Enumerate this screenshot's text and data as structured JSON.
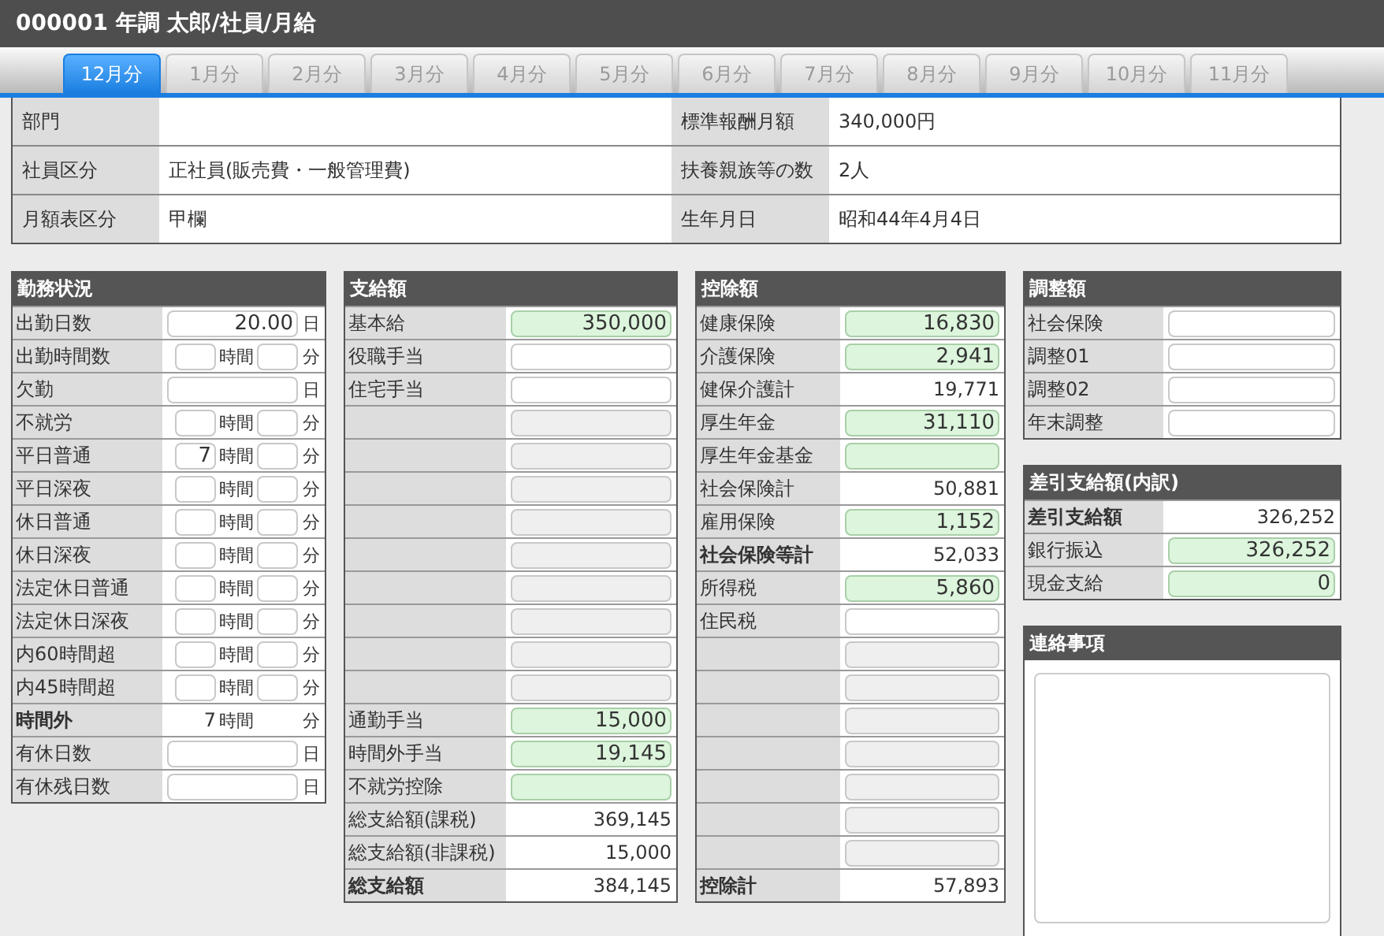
{
  "title": "000001 年調 太郎/社員/月給",
  "tabs": [
    {
      "label": "12月分",
      "selected": true
    },
    {
      "label": "1月分",
      "selected": false
    },
    {
      "label": "2月分",
      "selected": false
    },
    {
      "label": "3月分",
      "selected": false
    },
    {
      "label": "4月分",
      "selected": false
    },
    {
      "label": "5月分",
      "selected": false
    },
    {
      "label": "6月分",
      "selected": false
    },
    {
      "label": "7月分",
      "selected": false
    },
    {
      "label": "8月分",
      "selected": false
    },
    {
      "label": "9月分",
      "selected": false
    },
    {
      "label": "10月分",
      "selected": false
    },
    {
      "label": "11月分",
      "selected": false
    }
  ],
  "info": [
    {
      "label": "部門"
    },
    {
      "label": "標準報酬月額",
      "value": "340,000円"
    },
    {
      "label": "社員区分",
      "value": "正社員(販売費・一般管理費)"
    },
    {
      "label": "扶養親族等の数",
      "value": "2人"
    },
    {
      "label": "月額表区分",
      "value": "甲欄"
    },
    {
      "label": "生年月日",
      "value": "昭和44年4月4日"
    }
  ],
  "columns": [
    {
      "panels": [
        {
          "kind": "table",
          "title": "勤務状況",
          "rows": [
            {
              "kind": "days",
              "label": "出勤日数",
              "value": "20.00",
              "unit": "日"
            },
            {
              "kind": "time",
              "label": "出勤時間数",
              "hour_unit": "時間",
              "minute_unit": "分"
            },
            {
              "kind": "days",
              "label": "欠勤",
              "unit": "日"
            },
            {
              "kind": "time",
              "label": "不就労",
              "hour_unit": "時間",
              "minute_unit": "分"
            },
            {
              "kind": "time",
              "label": "平日普通",
              "hours": "7",
              "hour_unit": "時間",
              "minute_unit": "分"
            },
            {
              "kind": "time",
              "label": "平日深夜",
              "hour_unit": "時間",
              "minute_unit": "分"
            },
            {
              "kind": "time",
              "label": "休日普通",
              "hour_unit": "時間",
              "minute_unit": "分"
            },
            {
              "kind": "time",
              "label": "休日深夜",
              "hour_unit": "時間",
              "minute_unit": "分"
            },
            {
              "kind": "time",
              "label": "法定休日普通",
              "hour_unit": "時間",
              "minute_unit": "分"
            },
            {
              "kind": "time",
              "label": "法定休日深夜",
              "hour_unit": "時間",
              "minute_unit": "分"
            },
            {
              "kind": "time",
              "label": "内60時間超",
              "hour_unit": "時間",
              "minute_unit": "分"
            },
            {
              "kind": "time",
              "label": "内45時間超",
              "hour_unit": "時間",
              "minute_unit": "分"
            },
            {
              "kind": "time_total",
              "label": "時間外",
              "hours": "7",
              "hour_unit": "時間",
              "minute_unit": "分"
            },
            {
              "kind": "days",
              "label": "有休日数",
              "unit": "日"
            },
            {
              "kind": "days",
              "label": "有休残日数",
              "unit": "日"
            }
          ]
        }
      ]
    },
    {
      "panels": [
        {
          "kind": "table",
          "title": "支給額",
          "rows": [
            {
              "kind": "entry",
              "label": "基本給",
              "value": "350,000",
              "calculated": true
            },
            {
              "kind": "entry",
              "label": "役職手当",
              "calculated": false
            },
            {
              "kind": "entry",
              "label": "住宅手当",
              "calculated": false
            },
            {
              "kind": "blank"
            },
            {
              "kind": "blank"
            },
            {
              "kind": "blank"
            },
            {
              "kind": "blank"
            },
            {
              "kind": "blank"
            },
            {
              "kind": "blank"
            },
            {
              "kind": "blank"
            },
            {
              "kind": "blank"
            },
            {
              "kind": "blank"
            },
            {
              "kind": "entry",
              "label": "通勤手当",
              "value": "15,000",
              "calculated": true
            },
            {
              "kind": "entry",
              "label": "時間外手当",
              "value": "19,145",
              "calculated": true
            },
            {
              "kind": "entry",
              "label": "不就労控除",
              "calculated": true
            },
            {
              "kind": "sum",
              "label": "総支給額(課税)",
              "value": "369,145"
            },
            {
              "kind": "sum",
              "label": "総支給額(非課税)",
              "value": "15,000"
            },
            {
              "kind": "total",
              "label": "総支給額",
              "value": "384,145"
            }
          ]
        }
      ]
    },
    {
      "panels": [
        {
          "kind": "table",
          "title": "控除額",
          "rows": [
            {
              "kind": "entry",
              "label": "健康保険",
              "value": "16,830",
              "calculated": true
            },
            {
              "kind": "entry",
              "label": "介護保険",
              "value": "2,941",
              "calculated": true
            },
            {
              "kind": "sum",
              "label": "健保介護計",
              "value": "19,771"
            },
            {
              "kind": "entry",
              "label": "厚生年金",
              "value": "31,110",
              "calculated": true
            },
            {
              "kind": "entry",
              "label": "厚生年金基金",
              "calculated": true
            },
            {
              "kind": "sum",
              "label": "社会保険計",
              "value": "50,881"
            },
            {
              "kind": "entry",
              "label": "雇用保険",
              "value": "1,152",
              "calculated": true
            },
            {
              "kind": "total",
              "label": "社会保険等計",
              "value": "52,033"
            },
            {
              "kind": "entry",
              "label": "所得税",
              "value": "5,860",
              "calculated": true
            },
            {
              "kind": "entry",
              "label": "住民税",
              "calculated": false
            },
            {
              "kind": "blank"
            },
            {
              "kind": "blank"
            },
            {
              "kind": "blank"
            },
            {
              "kind": "blank"
            },
            {
              "kind": "blank"
            },
            {
              "kind": "blank"
            },
            {
              "kind": "blank"
            },
            {
              "kind": "total",
              "label": "控除計",
              "value": "57,893"
            }
          ]
        }
      ]
    },
    {
      "panels": [
        {
          "kind": "table",
          "title": "調整額",
          "rows": [
            {
              "kind": "entry",
              "label": "社会保険",
              "calculated": false
            },
            {
              "kind": "entry",
              "label": "調整01",
              "calculated": false
            },
            {
              "kind": "entry",
              "label": "調整02",
              "calculated": false
            },
            {
              "kind": "entry",
              "label": "年末調整",
              "calculated": false
            }
          ]
        },
        {
          "kind": "table",
          "title": "差引支給額(内訳)",
          "rows": [
            {
              "kind": "total",
              "label": "差引支給額",
              "value": "326,252"
            },
            {
              "kind": "entry",
              "label": "銀行振込",
              "value": "326,252",
              "calculated": true
            },
            {
              "kind": "entry",
              "label": "現金支給",
              "value": "0",
              "calculated": true
            }
          ]
        },
        {
          "kind": "notes",
          "title": "連絡事項"
        }
      ]
    }
  ]
}
